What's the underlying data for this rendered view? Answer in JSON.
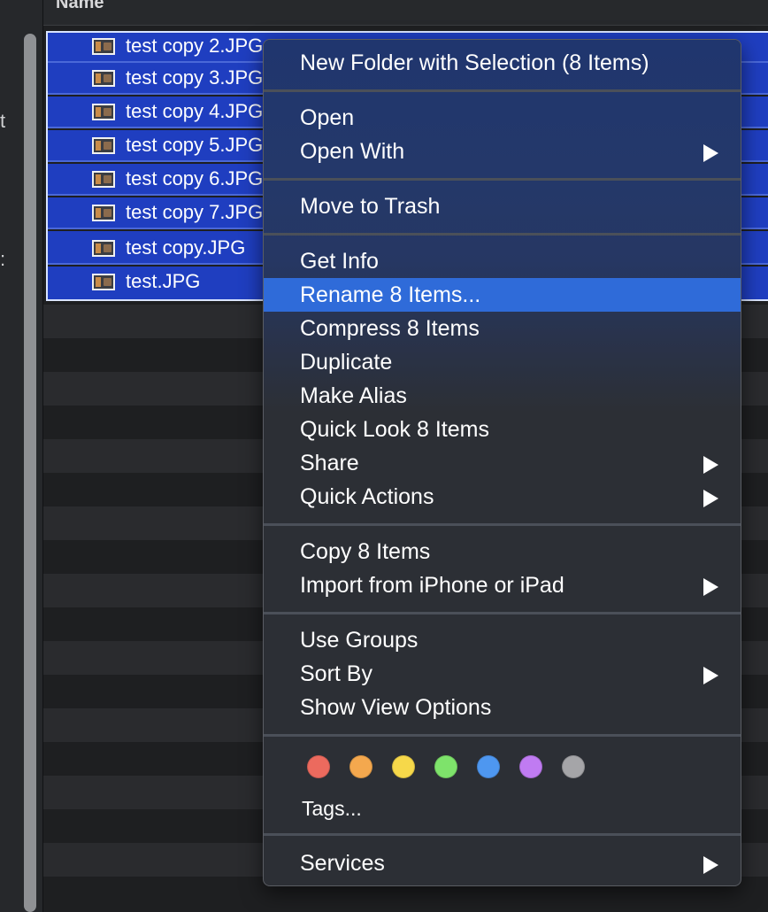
{
  "header": {
    "name_column": "Name"
  },
  "files": [
    {
      "name": "test copy 2.JPG"
    },
    {
      "name": "test copy 3.JPG"
    },
    {
      "name": "test copy 4.JPG"
    },
    {
      "name": "test copy 5.JPG"
    },
    {
      "name": "test copy 6.JPG"
    },
    {
      "name": "test copy 7.JPG"
    },
    {
      "name": "test copy.JPG"
    },
    {
      "name": "test.JPG"
    }
  ],
  "sidebar": {
    "glyph_1": "t",
    "glyph_2": ":"
  },
  "menu": {
    "new_folder": "New Folder with Selection (8 Items)",
    "open": "Open",
    "open_with": "Open With",
    "move_to_trash": "Move to Trash",
    "get_info": "Get Info",
    "rename": "Rename 8 Items...",
    "compress": "Compress 8 Items",
    "duplicate": "Duplicate",
    "make_alias": "Make Alias",
    "quick_look": "Quick Look 8 Items",
    "share": "Share",
    "quick_actions": "Quick Actions",
    "copy": "Copy 8 Items",
    "import_from_iphone": "Import from iPhone or iPad",
    "use_groups": "Use Groups",
    "sort_by": "Sort By",
    "show_view_options": "Show View Options",
    "tags": "Tags...",
    "services": "Services"
  },
  "tag_colors": {
    "red": "#ec6a5e",
    "orange": "#f4a84e",
    "yellow": "#f6d84a",
    "green": "#7ee36b",
    "blue": "#4e97f0",
    "purple": "#c07bf2",
    "gray": "#a5a5a8"
  },
  "theme": {
    "selection": "#1f3ec0",
    "highlight": "#2f6bd9",
    "menu_bg": "#2c2f35"
  }
}
